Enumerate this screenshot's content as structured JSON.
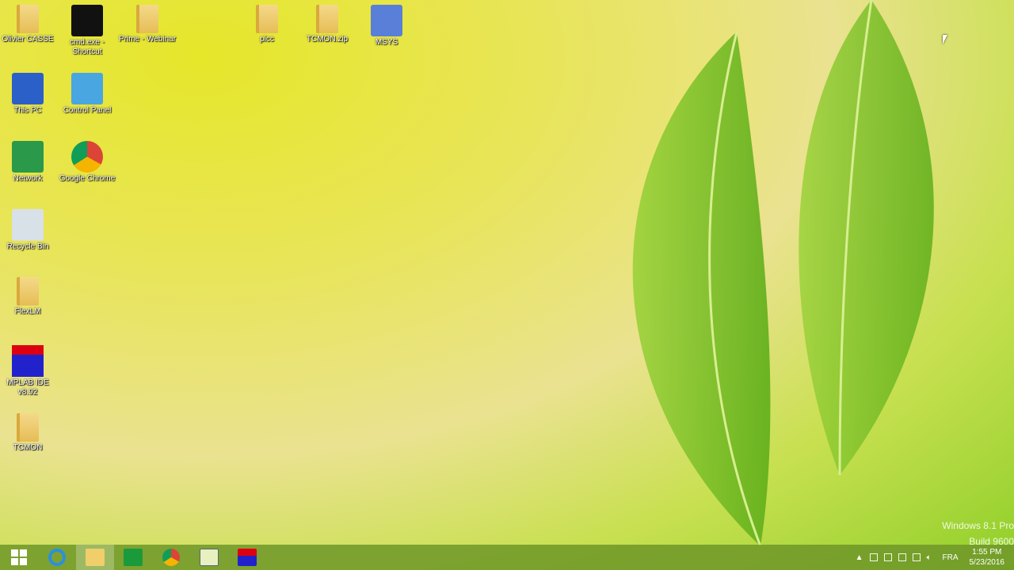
{
  "desktop": {
    "icons": [
      {
        "label": "Olivier CASSE",
        "type": "user-folder-icon"
      },
      {
        "label": "cmd.exe - Shortcut",
        "type": "cmd-icon"
      },
      {
        "label": "Prime - Webinar",
        "type": "folder-icon"
      },
      {
        "label": "picc",
        "type": "folder-icon"
      },
      {
        "label": "TCMON.zip",
        "type": "zip-folder-icon"
      },
      {
        "label": "MSYS",
        "type": "msys-icon"
      },
      {
        "label": "This PC",
        "type": "computer-icon"
      },
      {
        "label": "Control Panel",
        "type": "control-panel-icon"
      },
      {
        "label": "Network",
        "type": "network-icon"
      },
      {
        "label": "Google Chrome",
        "type": "chrome-icon"
      },
      {
        "label": "Recycle Bin",
        "type": "recycle-bin-icon"
      },
      {
        "label": "FlexLM",
        "type": "folder-icon"
      },
      {
        "label": "MPLAB IDE v8.92",
        "type": "mplab-icon"
      },
      {
        "label": "TCMON",
        "type": "folder-icon"
      }
    ]
  },
  "watermark": {
    "line1": "Windows 8.1 Pro",
    "line2": "Build 9600"
  },
  "taskbar": {
    "apps": [
      "start",
      "internet-explorer",
      "file-explorer",
      "store",
      "chrome",
      "app",
      "mplab"
    ],
    "tray": {
      "language": "FRA",
      "time": "1:55 PM",
      "date": "5/23/2016"
    }
  }
}
